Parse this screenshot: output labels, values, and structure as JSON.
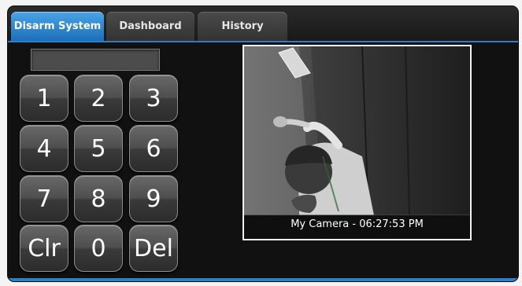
{
  "tabs": [
    {
      "label": "Disarm System",
      "active": true
    },
    {
      "label": "Dashboard",
      "active": false
    },
    {
      "label": "History",
      "active": false
    }
  ],
  "keypad": {
    "display_value": "",
    "keys": [
      "1",
      "2",
      "3",
      "4",
      "5",
      "6",
      "7",
      "8",
      "9",
      "Clr",
      "0",
      "Del"
    ]
  },
  "camera": {
    "caption": "My Camera - 06:27:53 PM"
  },
  "colors": {
    "accent": "#1c6fb8",
    "panel_bg": "#111111"
  }
}
